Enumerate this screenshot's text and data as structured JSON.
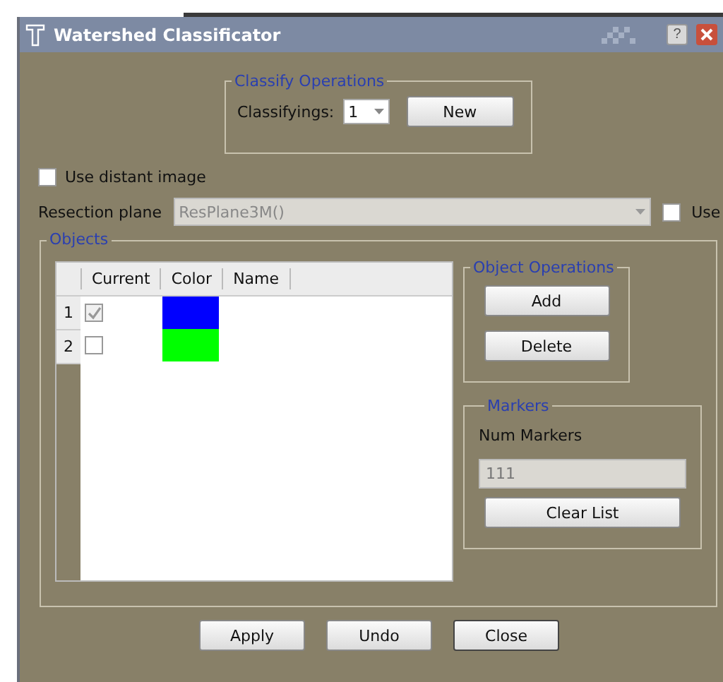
{
  "window": {
    "title": "Watershed Classificator",
    "help": "?"
  },
  "classify_operations": {
    "title": "Classify Operations",
    "label": "Classifyings:",
    "value": "1",
    "button": "New"
  },
  "use_distant_image": {
    "label": "Use distant image",
    "checked": false
  },
  "resection_plane": {
    "label": "Resection plane",
    "value": "ResPlane3M()",
    "disabled": true,
    "use": {
      "label": "Use",
      "checked": false
    }
  },
  "objects": {
    "title": "Objects",
    "table": {
      "columns": [
        "Current",
        "Color",
        "Name"
      ],
      "rows": [
        {
          "index": "1",
          "current": true,
          "disabled": true,
          "color": "#0000ff"
        },
        {
          "index": "2",
          "current": false,
          "disabled": false,
          "color": "#00ff00"
        }
      ]
    },
    "object_operations": {
      "title": "Object Operations",
      "buttons": [
        "Add",
        "Delete"
      ]
    },
    "markers": {
      "title": "Markers",
      "label": "Num Markers",
      "value": "111",
      "button": "Clear List"
    }
  },
  "buttons": [
    "Apply",
    "Undo",
    "Close"
  ]
}
